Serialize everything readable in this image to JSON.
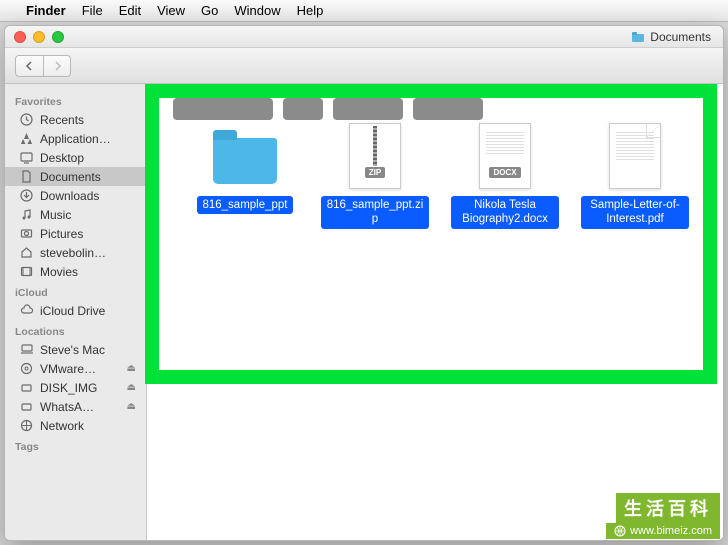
{
  "menubar": {
    "app": "Finder",
    "items": [
      "File",
      "Edit",
      "View",
      "Go",
      "Window",
      "Help"
    ]
  },
  "window": {
    "title": "Documents"
  },
  "sidebar": {
    "sections": [
      {
        "header": "Favorites",
        "items": [
          {
            "icon": "clock",
            "label": "Recents"
          },
          {
            "icon": "app",
            "label": "Application…"
          },
          {
            "icon": "desktop",
            "label": "Desktop"
          },
          {
            "icon": "doc",
            "label": "Documents",
            "selected": true
          },
          {
            "icon": "download",
            "label": "Downloads"
          },
          {
            "icon": "music",
            "label": "Music"
          },
          {
            "icon": "pictures",
            "label": "Pictures"
          },
          {
            "icon": "home",
            "label": "stevebolin…"
          },
          {
            "icon": "movies",
            "label": "Movies"
          }
        ]
      },
      {
        "header": "iCloud",
        "items": [
          {
            "icon": "cloud",
            "label": "iCloud Drive"
          }
        ]
      },
      {
        "header": "Locations",
        "items": [
          {
            "icon": "laptop",
            "label": "Steve's Mac"
          },
          {
            "icon": "disc",
            "label": "VMware…",
            "eject": true
          },
          {
            "icon": "drive",
            "label": "DISK_IMG",
            "eject": true
          },
          {
            "icon": "drive",
            "label": "WhatsA…",
            "eject": true
          },
          {
            "icon": "globe",
            "label": "Network"
          }
        ]
      },
      {
        "header": "Tags",
        "items": []
      }
    ]
  },
  "files": [
    {
      "type": "folder",
      "name": "816_sample_ppt"
    },
    {
      "type": "zip",
      "name": "816_sample_ppt.zip",
      "badge": "ZIP"
    },
    {
      "type": "docx",
      "name": "Nikola Tesla Biography2.docx",
      "badge": "DOCX"
    },
    {
      "type": "pdf",
      "name": "Sample-Letter-of-Interest.pdf"
    }
  ],
  "watermark": {
    "top": "生活百科",
    "url": "www.bimeiz.com"
  },
  "colors": {
    "highlight_border": "#00e23a",
    "selection": "#0a5cff",
    "folder": "#4db8e8"
  }
}
